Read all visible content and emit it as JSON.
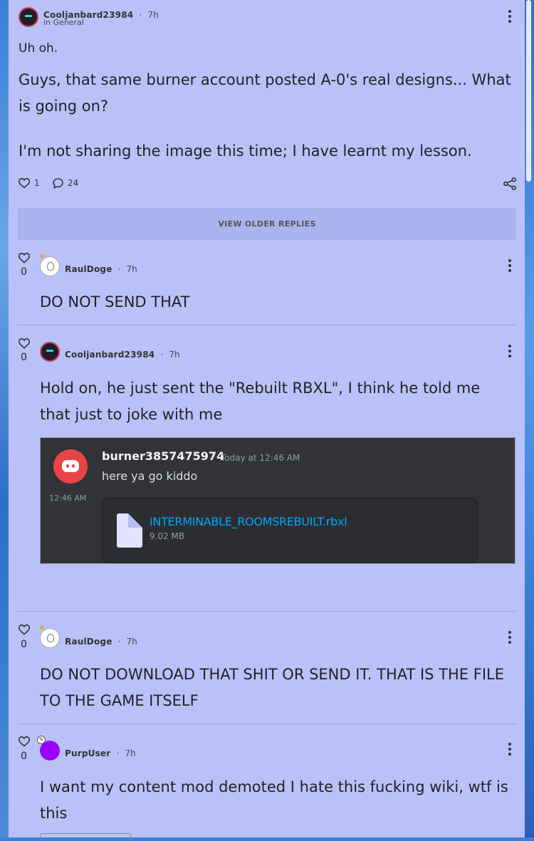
{
  "post": {
    "author": "Cooljanbard23984",
    "time": "7h",
    "sep": "·",
    "category": "in General",
    "title": "Uh oh.",
    "paragraphs": [
      "Guys, that same burner account posted A-0's real designs... What is going on?",
      "I'm not sharing the image this time; I have learnt my lesson."
    ],
    "likes": "1",
    "comments": "24",
    "icons": [
      "heart-icon",
      "comment-icon",
      "share-icon",
      "more-icon"
    ]
  },
  "view_older": "VIEW OLDER REPLIES",
  "replies": [
    {
      "likes": "0",
      "author": "RaulDoge",
      "time": "7h",
      "text": "DO NOT SEND THAT"
    },
    {
      "likes": "0",
      "author": "Cooljanbard23984",
      "time": "7h",
      "text": "Hold on, he just sent the \"Rebuilt RBXL\", I think he told me that just to joke with me",
      "attachment": {
        "username": "burner3857475974",
        "timestamp": "Today at 12:46 AM",
        "message": "here ya go kiddo",
        "side_time": "12:46 AM",
        "file_name": "INTERMINABLE_ROOMSREBUILT.rbxl",
        "file_size": "9.02 MB"
      }
    },
    {
      "likes": "0",
      "author": "RaulDoge",
      "time": "7h",
      "text": "DO NOT DOWNLOAD THAT SHIT OR SEND IT. THAT IS THE FILE TO THE GAME ITSELF"
    },
    {
      "likes": "0",
      "author": "PurpUser",
      "time": "7h",
      "text": "I want my content mod demoted I hate this fucking wiki, wtf is this"
    }
  ],
  "colors": {
    "panel": "#b8c2f9",
    "discord_bg": "#313338",
    "link": "#00a8fc",
    "purple_avatar": "#9b00ff"
  }
}
